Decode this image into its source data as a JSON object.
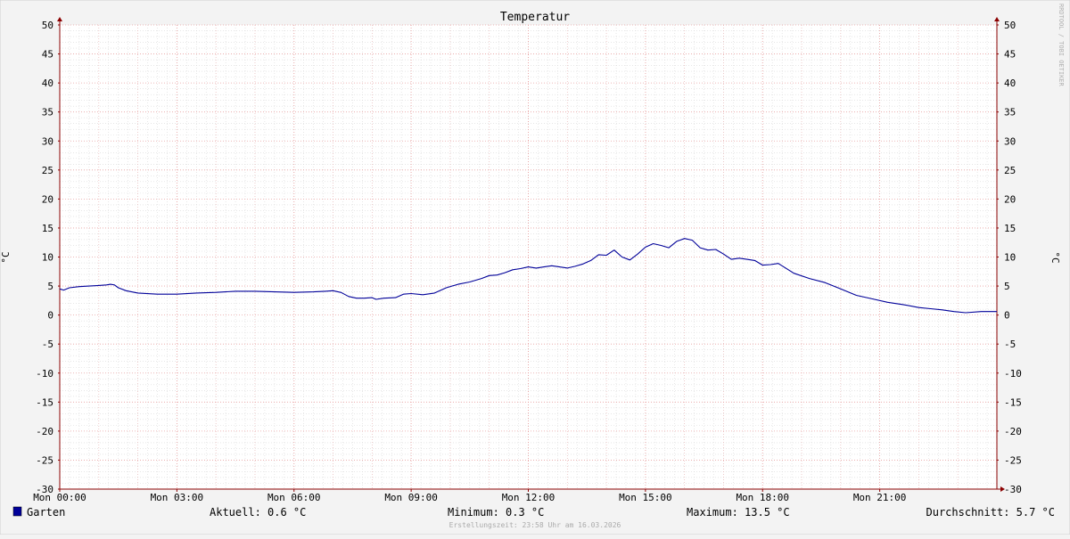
{
  "chart_data": {
    "type": "line",
    "title": "Temperatur",
    "ylabel_left": "°C",
    "ylabel_right": "°C",
    "ylim": [
      -30,
      50
    ],
    "y_ticks": [
      50,
      45,
      40,
      35,
      30,
      25,
      20,
      15,
      10,
      5,
      0,
      -5,
      -10,
      -15,
      -20,
      -25,
      -30
    ],
    "xlim": [
      0,
      24
    ],
    "x_ticks": [
      {
        "x": 0,
        "label": "Mon 00:00"
      },
      {
        "x": 3,
        "label": "Mon 03:00"
      },
      {
        "x": 6,
        "label": "Mon 06:00"
      },
      {
        "x": 9,
        "label": "Mon 09:00"
      },
      {
        "x": 12,
        "label": "Mon 12:00"
      },
      {
        "x": 15,
        "label": "Mon 15:00"
      },
      {
        "x": 18,
        "label": "Mon 18:00"
      },
      {
        "x": 21,
        "label": "Mon 21:00"
      }
    ],
    "grid": true,
    "series": [
      {
        "name": "Garten",
        "color": "#000099",
        "x": [
          0,
          0.1,
          0.25,
          0.5,
          0.75,
          1.0,
          1.2,
          1.3,
          1.4,
          1.5,
          1.7,
          2.0,
          2.5,
          3.0,
          3.5,
          4.0,
          4.5,
          5.0,
          5.5,
          6.0,
          6.5,
          6.8,
          7.0,
          7.2,
          7.4,
          7.6,
          7.8,
          8.0,
          8.1,
          8.3,
          8.6,
          8.8,
          9.0,
          9.3,
          9.6,
          9.9,
          10.2,
          10.5,
          10.8,
          11.0,
          11.2,
          11.4,
          11.6,
          11.8,
          12.0,
          12.2,
          12.4,
          12.6,
          12.8,
          13.0,
          13.2,
          13.4,
          13.6,
          13.8,
          14.0,
          14.2,
          14.4,
          14.6,
          14.8,
          15.0,
          15.2,
          15.4,
          15.6,
          15.8,
          16.0,
          16.2,
          16.4,
          16.6,
          16.8,
          17.0,
          17.2,
          17.4,
          17.6,
          17.8,
          18.0,
          18.2,
          18.4,
          18.8,
          19.2,
          19.6,
          20.0,
          20.4,
          20.8,
          21.2,
          21.6,
          22.0,
          22.3,
          22.6,
          22.9,
          23.2,
          23.6,
          24.0
        ],
        "values": [
          4.5,
          4.3,
          4.7,
          4.9,
          5.0,
          5.1,
          5.2,
          5.3,
          5.2,
          4.7,
          4.2,
          3.8,
          3.6,
          3.6,
          3.8,
          3.9,
          4.1,
          4.1,
          4.0,
          3.9,
          4.0,
          4.1,
          4.2,
          3.9,
          3.2,
          2.9,
          2.9,
          3.0,
          2.7,
          2.9,
          3.0,
          3.6,
          3.7,
          3.5,
          3.8,
          4.7,
          5.3,
          5.7,
          6.3,
          6.8,
          6.9,
          7.3,
          7.8,
          8.0,
          8.3,
          8.1,
          8.3,
          8.5,
          8.3,
          8.1,
          8.4,
          8.8,
          9.4,
          10.4,
          10.3,
          11.2,
          10.0,
          9.5,
          10.5,
          11.7,
          12.3,
          12.0,
          11.6,
          12.7,
          13.2,
          12.9,
          11.6,
          11.2,
          11.3,
          10.5,
          9.6,
          9.8,
          9.6,
          9.4,
          8.6,
          8.7,
          8.9,
          7.2,
          6.3,
          5.6,
          4.5,
          3.4,
          2.8,
          2.2,
          1.8,
          1.3,
          1.1,
          0.9,
          0.6,
          0.4,
          0.6,
          0.6
        ]
      }
    ]
  },
  "legend": {
    "series_name": "Garten",
    "swatch_color": "#000099"
  },
  "stats": {
    "current": "Aktuell: 0.6 °C",
    "minimum": "Minimum: 0.3 °C",
    "maximum": "Maximum: 13.5 °C",
    "average": "Durchschnitt: 5.7 °C"
  },
  "footer": {
    "timestamp": "Erstellungszeit: 23:58 Uhr am 16.03.2026"
  },
  "watermark": "RRDTOOL / TOBI OETIKER",
  "colors": {
    "background": "#f3f3f3",
    "plot_background": "#ffffff",
    "major_grid": "#e8a0a0",
    "minor_grid": "#d8d8d8",
    "axis": "#8b0000",
    "text": "#000000"
  }
}
